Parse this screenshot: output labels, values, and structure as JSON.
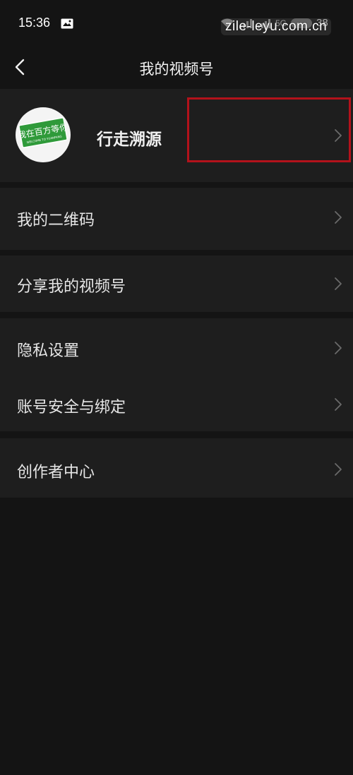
{
  "status_bar": {
    "time": "15:36",
    "network": "5G",
    "battery": "38",
    "watermark": "zile-leyu.com.cn"
  },
  "nav": {
    "title": "我的视频号"
  },
  "profile": {
    "name": "行走溯源",
    "avatar_sign_text": "我在百方等你",
    "avatar_sign_subtext": "WELCOME TO YUANFANG"
  },
  "menu": {
    "qr_code": "我的二维码",
    "share": "分享我的视频号",
    "privacy": "隐私设置",
    "account_security": "账号安全与绑定",
    "creator_center": "创作者中心"
  },
  "colors": {
    "background": "#141414",
    "section": "#1e1e1e",
    "highlight": "#b3121b",
    "sign_green": "#2f9a3a"
  }
}
